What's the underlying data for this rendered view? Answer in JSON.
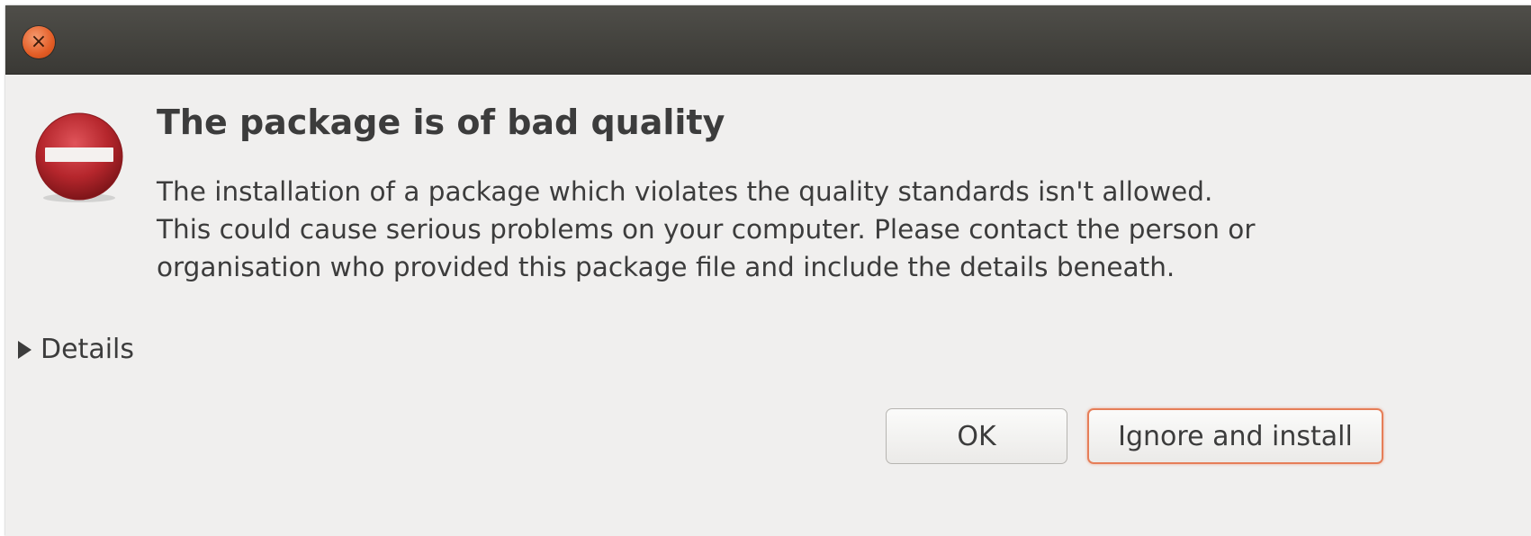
{
  "titlebar": {
    "close_glyph": "×",
    "close_icon": "close-icon"
  },
  "dialog": {
    "icon": "error-icon",
    "heading": "The package is of bad quality",
    "body_lines": [
      "The installation of a package which violates the quality standards isn't allowed.",
      "This could cause serious problems on your computer. Please contact the person or",
      "organisation who provided this package file and include the details beneath."
    ],
    "details_label": "Details"
  },
  "buttons": {
    "ok_label": "OK",
    "ignore_install_label": "Ignore and install"
  },
  "colors": {
    "titlebar": "#3c3b37",
    "close_button": "#e35d26",
    "error_icon": "#b5262c",
    "default_button_border": "#e67e58",
    "background": "#f0efee"
  }
}
